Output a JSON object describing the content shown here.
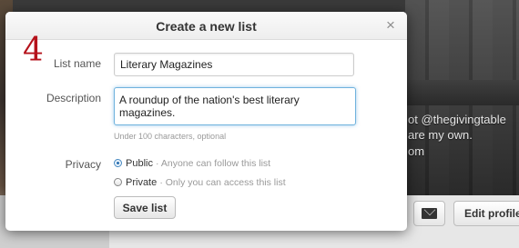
{
  "dialog": {
    "title": "Create a new list",
    "close_glyph": "×",
    "step_number": "4"
  },
  "form": {
    "list_name_label": "List name",
    "list_name_value": "Literary Magazines",
    "description_label": "Description",
    "description_value": "A roundup of the nation's best literary magazines.",
    "description_hint": "Under 100 characters, optional",
    "privacy_label": "Privacy",
    "privacy_options": [
      {
        "label": "Public",
        "description": "· Anyone can follow this list",
        "selected": true
      },
      {
        "label": "Private",
        "description": "· Only you can access this list",
        "selected": false
      }
    ],
    "save_label": "Save list"
  },
  "background": {
    "profile_text_lines": [
      "ot @thegivingtable",
      "are my own.",
      "om"
    ],
    "edit_profile_label": "Edit profile",
    "mail_icon": "envelope-icon"
  },
  "colors": {
    "step_number": "#b5121b",
    "focus_border": "#6fb2dd"
  }
}
